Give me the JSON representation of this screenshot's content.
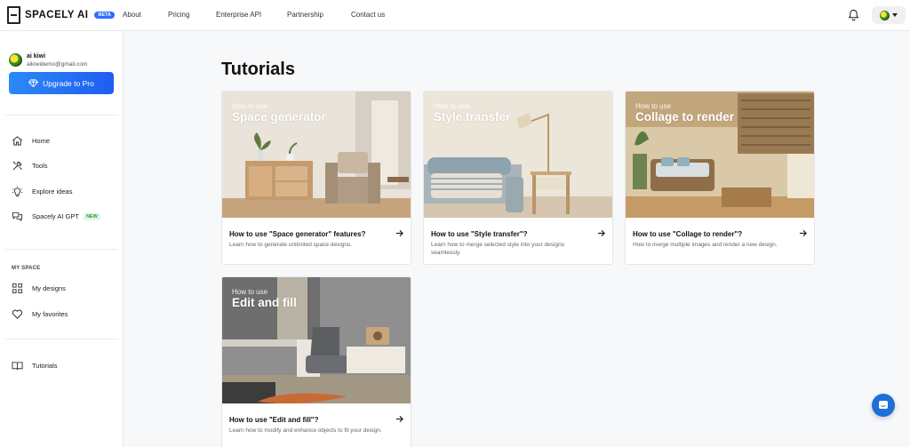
{
  "brand": {
    "name": "SPACELY AI",
    "badge": "BETA"
  },
  "nav": {
    "about": "About",
    "pricing": "Pricing",
    "api": "Enterprise API",
    "partnership": "Partnership",
    "contact": "Contact us"
  },
  "user": {
    "name": "ai kiwi",
    "email": "aikiwidemo@gmail.com"
  },
  "sidebar": {
    "upgrade": "Upgrade to Pro",
    "home": "Home",
    "tools": "Tools",
    "explore": "Explore ideas",
    "gpt": "Spacely AI GPT",
    "gpt_badge": "NEW",
    "my_space": "MY SPACE",
    "designs": "My designs",
    "favorites": "My favorites",
    "tutorials": "Tutorials"
  },
  "page": {
    "title": "Tutorials"
  },
  "cards": [
    {
      "pre": "How to use",
      "big": "Space generator",
      "title": "How to use \"Space generator\" features?",
      "desc": "Learn how to generate unlimited space designs."
    },
    {
      "pre": "How to use",
      "big": "Style transfer",
      "title": "How to use \"Style transfer\"?",
      "desc": "Learn how to merge selected style into your designs seamlessly."
    },
    {
      "pre": "How to use",
      "big": "Collage to render",
      "title": "How to use \"Collage to render\"?",
      "desc": "How to merge multiple images and render a new design."
    },
    {
      "pre": "How to use",
      "big": "Edit and fill",
      "title": "How to use \"Edit and fill\"?",
      "desc": "Learn how to modify and enhance objects to fit your design."
    }
  ]
}
